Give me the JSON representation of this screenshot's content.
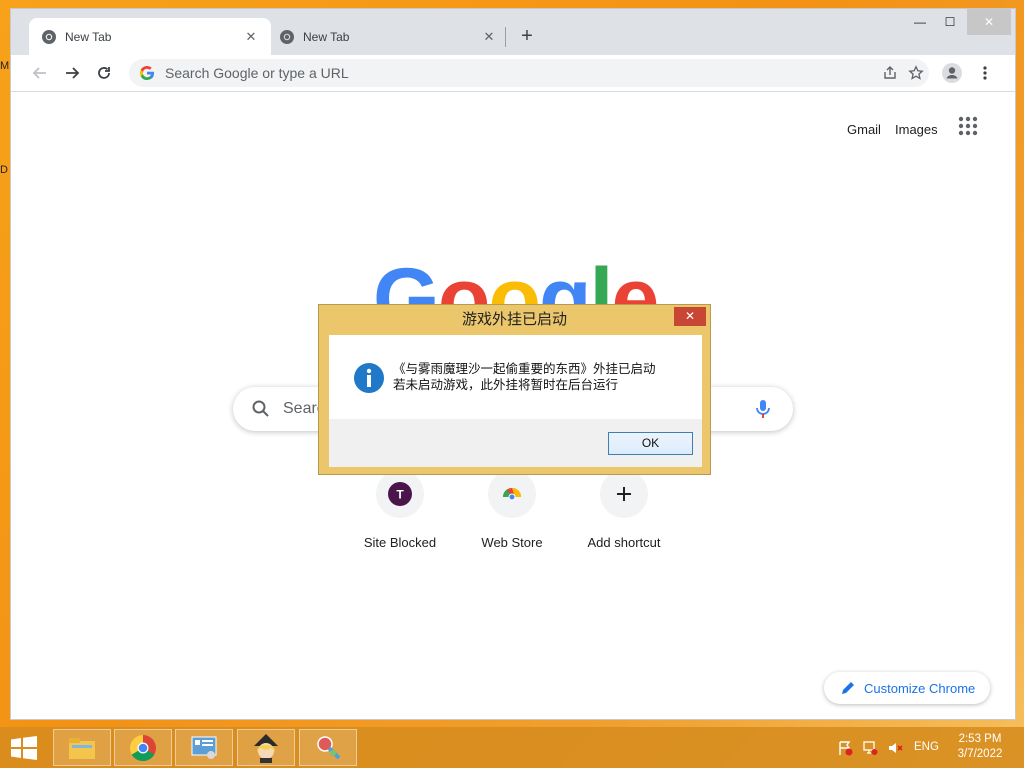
{
  "desktop": {
    "edge_glyphs": [
      "M",
      "D"
    ]
  },
  "browser": {
    "tabs": [
      {
        "title": "New Tab",
        "active": true
      },
      {
        "title": "New Tab",
        "active": false
      }
    ],
    "window_controls": {
      "minimize": "—",
      "maximize": "☐",
      "close": "✕"
    },
    "omnibox_placeholder": "Search Google or type a URL"
  },
  "ntp": {
    "top_links": [
      "Gmail",
      "Images"
    ],
    "logo_letters": [
      {
        "ch": "G",
        "color": "#4285f4"
      },
      {
        "ch": "o",
        "color": "#ea4335"
      },
      {
        "ch": "o",
        "color": "#fbbc05"
      },
      {
        "ch": "g",
        "color": "#4285f4"
      },
      {
        "ch": "l",
        "color": "#34a853"
      },
      {
        "ch": "e",
        "color": "#ea4335"
      }
    ],
    "search_placeholder": "Search",
    "shortcuts": [
      {
        "label": "Site Blocked",
        "icon": "t-letter-icon",
        "letter": "T"
      },
      {
        "label": "Web Store",
        "icon": "chrome-webstore-icon"
      },
      {
        "label": "Add shortcut",
        "icon": "plus-icon"
      }
    ],
    "customize_label": "Customize Chrome"
  },
  "dialog": {
    "title": "游戏外挂已启动",
    "close": "✕",
    "message_line1": "《与雾雨魔理沙一起偷重要的东西》外挂已启动",
    "message_line2": "若未启动游戏，此外挂将暂时在后台运行",
    "ok_label": "OK"
  },
  "taskbar": {
    "apps": [
      "file-explorer-icon",
      "chrome-icon",
      "control-panel-icon",
      "touhou-game-icon",
      "tool-app-icon"
    ],
    "language": "ENG",
    "time": "2:53 PM",
    "date": "3/7/2022"
  },
  "colors": {
    "accent_blue": "#1a73e8",
    "dialog_frame": "#ecc66a",
    "dialog_close": "#c84634"
  }
}
